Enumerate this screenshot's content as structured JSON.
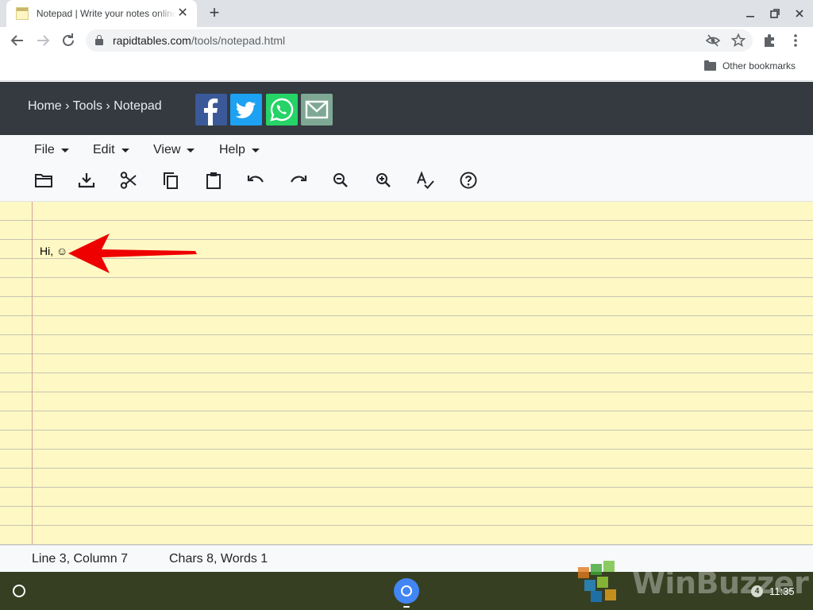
{
  "browser": {
    "tab_title": "Notepad | Write your notes online",
    "tab_close": "✕",
    "new_tab": "+",
    "url_host": "rapidtables.com",
    "url_path": "/tools/notepad.html",
    "bookmark_folder": "Other bookmarks"
  },
  "site": {
    "breadcrumb": "Home › Tools › Notepad"
  },
  "menu": {
    "file": "File",
    "edit": "Edit",
    "view": "View",
    "help": "Help"
  },
  "toolbar_icons": [
    "open-folder-icon",
    "download-icon",
    "scissors-icon",
    "copy-icon",
    "paste-icon",
    "undo-icon",
    "redo-icon",
    "zoom-out-icon",
    "zoom-in-icon",
    "spellcheck-icon",
    "help-icon"
  ],
  "editor": {
    "text": "Hi, ☺"
  },
  "status": {
    "position": "Line 3, Column 7",
    "counts": "Chars 8, Words 1"
  },
  "shelf": {
    "notification_count": "4",
    "time": "11:35",
    "watermark": "WinBuzzer"
  },
  "colors": {
    "header_bg": "#343a40",
    "paper": "#fdf8c4",
    "arrow": "#ee0000",
    "shelf": "#363f22"
  }
}
